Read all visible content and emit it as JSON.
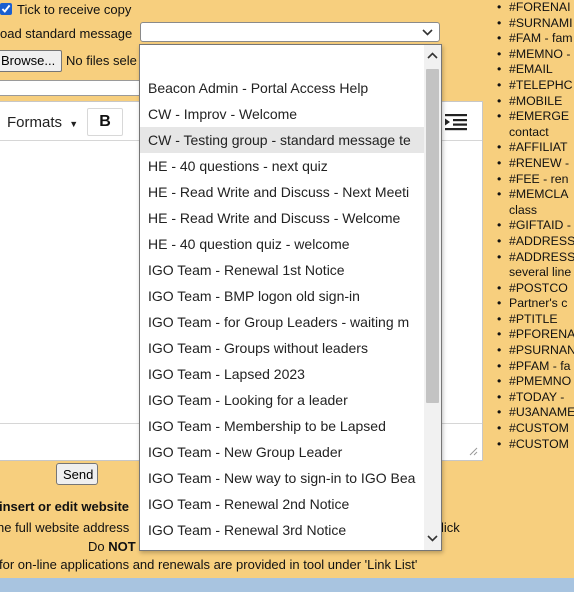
{
  "form": {
    "tick_label": "Tick to receive copy",
    "load_label": "oad standard message",
    "browse_label": "Browse...",
    "no_files_label": "No files sele",
    "send_label": "Send"
  },
  "editor": {
    "formats_label": "Formats",
    "bold_label": "B"
  },
  "help": {
    "line1": "insert or edit website",
    "line2": "he full website address",
    "line2_tail": "lick",
    "line3_prefix": "Do",
    "line3_bold": "NOT",
    "line4": "for on-line applications and renewals are provided in tool under 'Link List'"
  },
  "tokens": [
    "#FORENAI",
    "#SURNAMI",
    "#FAM - fam",
    "#MEMNO -",
    "#EMAIL",
    "#TELEPHC",
    "#MOBILE",
    [
      "#EMERGE",
      "contact"
    ],
    "#AFFILIAT",
    "#RENEW -",
    "#FEE - ren",
    [
      "#MEMCLA",
      "class"
    ],
    "#GIFTAID -",
    "#ADDRESS",
    [
      "#ADDRESS",
      "several line"
    ],
    "#POSTCO",
    "Partner's c",
    "#PTITLE",
    "#PFORENA",
    "#PSURNAN",
    "#PFAM - fa",
    "#PMEMNO",
    "#TODAY -",
    "#U3ANAME",
    "#CUSTOM",
    "#CUSTOM"
  ],
  "dropdown": {
    "options": [
      "",
      "Beacon Admin - Portal Access Help",
      "CW - Improv - Welcome",
      "CW - Testing group - standard message te",
      "HE - 40 questions - next quiz",
      "HE - Read Write and Discuss - Next Meeti",
      "HE - Read Write and Discuss - Welcome",
      "HE - 40 question quiz - welcome",
      "IGO Team - Renewal 1st Notice",
      "IGO Team - BMP logon old sign-in",
      "IGO Team - for Group Leaders - waiting m",
      "IGO Team - Groups without leaders",
      "IGO Team - Lapsed 2023",
      "IGO Team - Looking for a leader",
      "IGO Team - Membership to be Lapsed",
      "IGO Team - New Group Leader",
      "IGO Team - New way to sign-in to IGO Bea",
      "IGO Team - Renewal 2nd Notice",
      "IGO Team - Renewal 3rd Notice"
    ],
    "highlighted": "CW - Testing group - standard message te"
  },
  "colors": {
    "page_background": "#f7cf7e",
    "highlight": "#e6e6e6",
    "bottom_bar": "#a8c4e0"
  }
}
